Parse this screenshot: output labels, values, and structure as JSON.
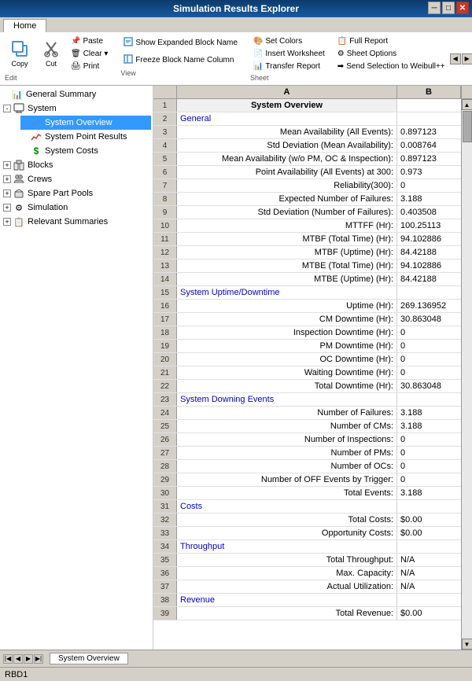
{
  "titleBar": {
    "title": "Simulation Results Explorer",
    "minBtn": "─",
    "maxBtn": "□",
    "closeBtn": "✕"
  },
  "tabs": [
    {
      "label": "Home",
      "active": true
    }
  ],
  "ribbon": {
    "groups": [
      {
        "name": "Edit",
        "items": [
          {
            "type": "large",
            "icon": "📋",
            "label": "Copy",
            "name": "copy-button"
          },
          {
            "type": "large",
            "icon": "✂",
            "label": "Cut",
            "name": "cut-button"
          },
          {
            "type": "col",
            "items": [
              {
                "label": "Paste",
                "icon": "📌"
              },
              {
                "label": "Clear ▾",
                "icon": "🗑"
              },
              {
                "label": "Print",
                "icon": "🖨"
              }
            ]
          }
        ]
      },
      {
        "name": "View",
        "items": [
          {
            "type": "col",
            "items": [
              {
                "label": "Show Expanded Block Name"
              },
              {
                "label": "Freeze Block Name Column"
              }
            ]
          }
        ]
      },
      {
        "name": "Sheet",
        "items": [
          {
            "type": "col",
            "items": [
              {
                "label": "Set Colors",
                "icon": "🎨"
              },
              {
                "label": "Insert Worksheet",
                "icon": "📄"
              },
              {
                "label": "Transfer Report",
                "icon": "📊"
              }
            ]
          },
          {
            "type": "col",
            "items": [
              {
                "label": "Full Report",
                "icon": "📋"
              },
              {
                "label": "Sheet Options",
                "icon": "⚙"
              },
              {
                "label": "Send Selection to Weibull++",
                "icon": "➡"
              }
            ]
          }
        ]
      }
    ]
  },
  "tree": {
    "items": [
      {
        "id": "general-summary",
        "label": "General Summary",
        "level": 0,
        "expand": null,
        "icon": "📊",
        "iconColor": "#333"
      },
      {
        "id": "system",
        "label": "System",
        "level": 0,
        "expand": "-",
        "icon": "🖥",
        "iconColor": "#333"
      },
      {
        "id": "system-overview",
        "label": "System Overview",
        "level": 2,
        "expand": null,
        "icon": "📈",
        "iconColor": "#0066cc",
        "selected": true
      },
      {
        "id": "system-point-results",
        "label": "System Point Results",
        "level": 2,
        "expand": null,
        "icon": "📉",
        "iconColor": "#cc0000"
      },
      {
        "id": "system-costs",
        "label": "System Costs",
        "level": 2,
        "expand": null,
        "icon": "💲",
        "iconColor": "#00aa00"
      },
      {
        "id": "blocks",
        "label": "Blocks",
        "level": 0,
        "expand": "+",
        "icon": "📦",
        "iconColor": "#333"
      },
      {
        "id": "crews",
        "label": "Crews",
        "level": 0,
        "expand": "+",
        "icon": "👥",
        "iconColor": "#333"
      },
      {
        "id": "spare-part-pools",
        "label": "Spare Part Pools",
        "level": 0,
        "expand": "+",
        "icon": "🔧",
        "iconColor": "#333"
      },
      {
        "id": "simulation",
        "label": "Simulation",
        "level": 0,
        "expand": "+",
        "icon": "⚙",
        "iconColor": "#333"
      },
      {
        "id": "relevant-summaries",
        "label": "Relevant Summaries",
        "level": 0,
        "expand": "+",
        "icon": "📋",
        "iconColor": "#333"
      }
    ]
  },
  "spreadsheet": {
    "columns": [
      {
        "label": "A",
        "class": "col-a"
      },
      {
        "label": "B",
        "class": "col-b"
      }
    ],
    "rows": [
      {
        "num": 1,
        "a": "System Overview",
        "b": "",
        "aStyle": "center bold bg-gray",
        "bStyle": ""
      },
      {
        "num": 2,
        "a": "General",
        "b": "",
        "aStyle": "blue",
        "bStyle": ""
      },
      {
        "num": 3,
        "a": "Mean Availability (All Events):",
        "b": "0.897123",
        "aStyle": "right",
        "bStyle": ""
      },
      {
        "num": 4,
        "a": "Std Deviation (Mean Availability):",
        "b": "0.008764",
        "aStyle": "right",
        "bStyle": ""
      },
      {
        "num": 5,
        "a": "Mean Availability (w/o PM, OC & Inspection):",
        "b": "0.897123",
        "aStyle": "right",
        "bStyle": ""
      },
      {
        "num": 6,
        "a": "Point Availability (All Events) at 300:",
        "b": "0.973",
        "aStyle": "right",
        "bStyle": ""
      },
      {
        "num": 7,
        "a": "Reliability(300):",
        "b": "0",
        "aStyle": "right",
        "bStyle": ""
      },
      {
        "num": 8,
        "a": "Expected Number of Failures:",
        "b": "3.188",
        "aStyle": "right",
        "bStyle": ""
      },
      {
        "num": 9,
        "a": "Std Deviation (Number of Failures):",
        "b": "0.403508",
        "aStyle": "right",
        "bStyle": ""
      },
      {
        "num": 10,
        "a": "MTTFF (Hr):",
        "b": "100.25113",
        "aStyle": "right",
        "bStyle": ""
      },
      {
        "num": 11,
        "a": "MTBF (Total Time) (Hr):",
        "b": "94.102886",
        "aStyle": "right",
        "bStyle": ""
      },
      {
        "num": 12,
        "a": "MTBF (Uptime) (Hr):",
        "b": "84.42188",
        "aStyle": "right",
        "bStyle": ""
      },
      {
        "num": 13,
        "a": "MTBE (Total Time) (Hr):",
        "b": "94.102886",
        "aStyle": "right",
        "bStyle": ""
      },
      {
        "num": 14,
        "a": "MTBE (Uptime) (Hr):",
        "b": "84.42188",
        "aStyle": "right",
        "bStyle": ""
      },
      {
        "num": 15,
        "a": "System Uptime/Downtime",
        "b": "",
        "aStyle": "blue",
        "bStyle": ""
      },
      {
        "num": 16,
        "a": "Uptime (Hr):",
        "b": "269.136952",
        "aStyle": "right",
        "bStyle": ""
      },
      {
        "num": 17,
        "a": "CM Downtime (Hr):",
        "b": "30.863048",
        "aStyle": "right",
        "bStyle": ""
      },
      {
        "num": 18,
        "a": "Inspection Downtime (Hr):",
        "b": "0",
        "aStyle": "right",
        "bStyle": ""
      },
      {
        "num": 19,
        "a": "PM Downtime (Hr):",
        "b": "0",
        "aStyle": "right",
        "bStyle": ""
      },
      {
        "num": 20,
        "a": "OC Downtime (Hr):",
        "b": "0",
        "aStyle": "right",
        "bStyle": ""
      },
      {
        "num": 21,
        "a": "Waiting Downtime (Hr):",
        "b": "0",
        "aStyle": "right",
        "bStyle": ""
      },
      {
        "num": 22,
        "a": "Total Downtime (Hr):",
        "b": "30.863048",
        "aStyle": "right",
        "bStyle": ""
      },
      {
        "num": 23,
        "a": "System Downing Events",
        "b": "",
        "aStyle": "blue",
        "bStyle": ""
      },
      {
        "num": 24,
        "a": "Number of Failures:",
        "b": "3.188",
        "aStyle": "right",
        "bStyle": ""
      },
      {
        "num": 25,
        "a": "Number of CMs:",
        "b": "3.188",
        "aStyle": "right",
        "bStyle": ""
      },
      {
        "num": 26,
        "a": "Number of Inspections:",
        "b": "0",
        "aStyle": "right",
        "bStyle": ""
      },
      {
        "num": 27,
        "a": "Number of PMs:",
        "b": "0",
        "aStyle": "right",
        "bStyle": ""
      },
      {
        "num": 28,
        "a": "Number of OCs:",
        "b": "0",
        "aStyle": "right",
        "bStyle": ""
      },
      {
        "num": 29,
        "a": "Number of OFF Events by Trigger:",
        "b": "0",
        "aStyle": "right",
        "bStyle": ""
      },
      {
        "num": 30,
        "a": "Total Events:",
        "b": "3.188",
        "aStyle": "right",
        "bStyle": ""
      },
      {
        "num": 31,
        "a": "Costs",
        "b": "",
        "aStyle": "blue",
        "bStyle": ""
      },
      {
        "num": 32,
        "a": "Total Costs:",
        "b": "$0.00",
        "aStyle": "right",
        "bStyle": ""
      },
      {
        "num": 33,
        "a": "Opportunity Costs:",
        "b": "$0.00",
        "aStyle": "right",
        "bStyle": ""
      },
      {
        "num": 34,
        "a": "Throughput",
        "b": "",
        "aStyle": "blue",
        "bStyle": ""
      },
      {
        "num": 35,
        "a": "Total Throughput:",
        "b": "N/A",
        "aStyle": "right",
        "bStyle": ""
      },
      {
        "num": 36,
        "a": "Max. Capacity:",
        "b": "N/A",
        "aStyle": "right",
        "bStyle": ""
      },
      {
        "num": 37,
        "a": "Actual Utilization:",
        "b": "N/A",
        "aStyle": "right",
        "bStyle": ""
      },
      {
        "num": 38,
        "a": "Revenue",
        "b": "",
        "aStyle": "blue",
        "bStyle": ""
      },
      {
        "num": 39,
        "a": "Total Revenue:",
        "b": "$0.00",
        "aStyle": "right",
        "bStyle": ""
      }
    ]
  },
  "bottomTab": "System Overview",
  "statusBar": "RBD1"
}
